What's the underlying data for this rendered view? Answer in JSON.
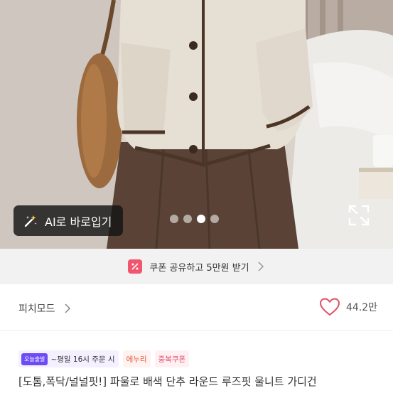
{
  "photo": {
    "ai_button_label": "AI로 바로입기",
    "carousel": {
      "count": 4,
      "active_index": 2
    }
  },
  "coupon_banner": {
    "text": "쿠폰 공유하고 5만원 받기"
  },
  "brand": {
    "name": "피치모드",
    "like_count": "44.2만"
  },
  "product": {
    "tags": [
      {
        "pill": "오늘출발",
        "text": "~평일 16시 주문 시"
      },
      {
        "text": "에누리"
      },
      {
        "text": "중복쿠폰"
      }
    ],
    "title": "[도톰,폭닥/널널핏!] 파울로 배색 단추 라운드 루즈핏 울니트 가디건"
  },
  "colors": {
    "accent_purple": "#6d4cf5",
    "coupon_red": "#f1566e",
    "heart_red": "#e24c67"
  }
}
